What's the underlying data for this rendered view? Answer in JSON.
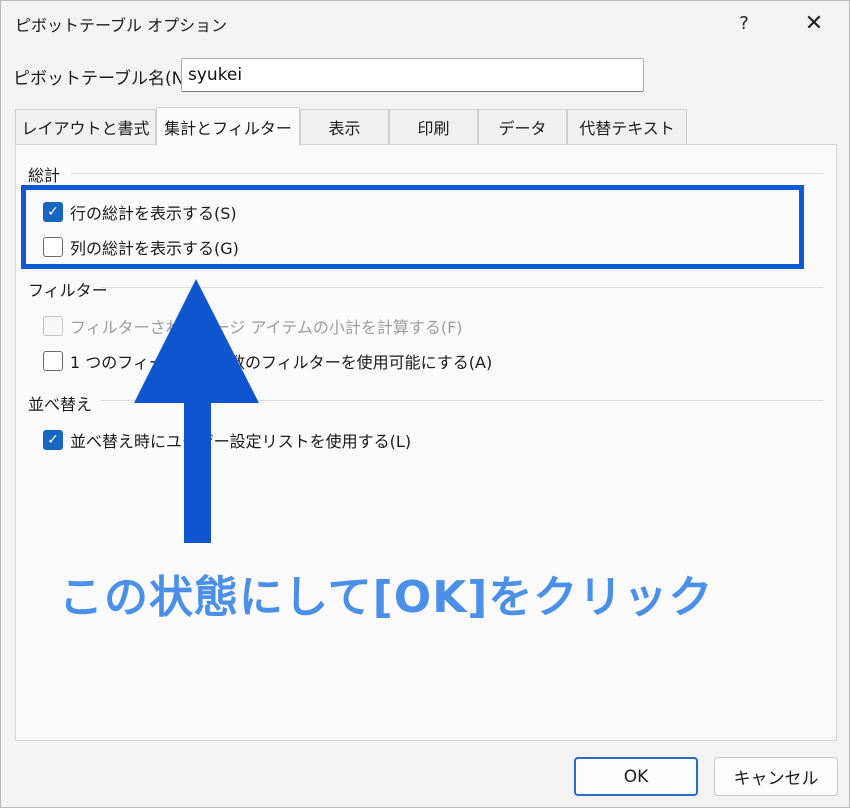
{
  "dialog": {
    "title": "ピボットテーブル オプション",
    "help_glyph": "?",
    "close_glyph": "✕"
  },
  "name_field": {
    "label": "ピボットテーブル名(N):",
    "value": "syukei"
  },
  "tabs": [
    {
      "label": "レイアウトと書式",
      "active": false
    },
    {
      "label": "集計とフィルター",
      "active": true
    },
    {
      "label": "表示",
      "active": false
    },
    {
      "label": "印刷",
      "active": false
    },
    {
      "label": "データ",
      "active": false
    },
    {
      "label": "代替テキスト",
      "active": false
    }
  ],
  "sections": {
    "totals": {
      "title": "総計",
      "options": [
        {
          "label": "行の総計を表示する(S)",
          "checked": true,
          "enabled": true
        },
        {
          "label": "列の総計を表示する(G)",
          "checked": false,
          "enabled": true
        }
      ]
    },
    "filters": {
      "title": "フィルター",
      "options": [
        {
          "label": "フィルターされたページ アイテムの小計を計算する(F)",
          "checked": false,
          "enabled": false
        },
        {
          "label": "1 つのフィールドで複数のフィルターを使用可能にする(A)",
          "checked": false,
          "enabled": true
        }
      ]
    },
    "sort": {
      "title": "並べ替え",
      "options": [
        {
          "label": "並べ替え時にユーザー設定リストを使用する(L)",
          "checked": true,
          "enabled": true
        }
      ]
    }
  },
  "annotation": {
    "callout_text": "この状態にして[OK]をクリック",
    "accent_color": "#1059d6"
  },
  "footer": {
    "ok_label": "OK",
    "cancel_label": "キャンセル"
  }
}
